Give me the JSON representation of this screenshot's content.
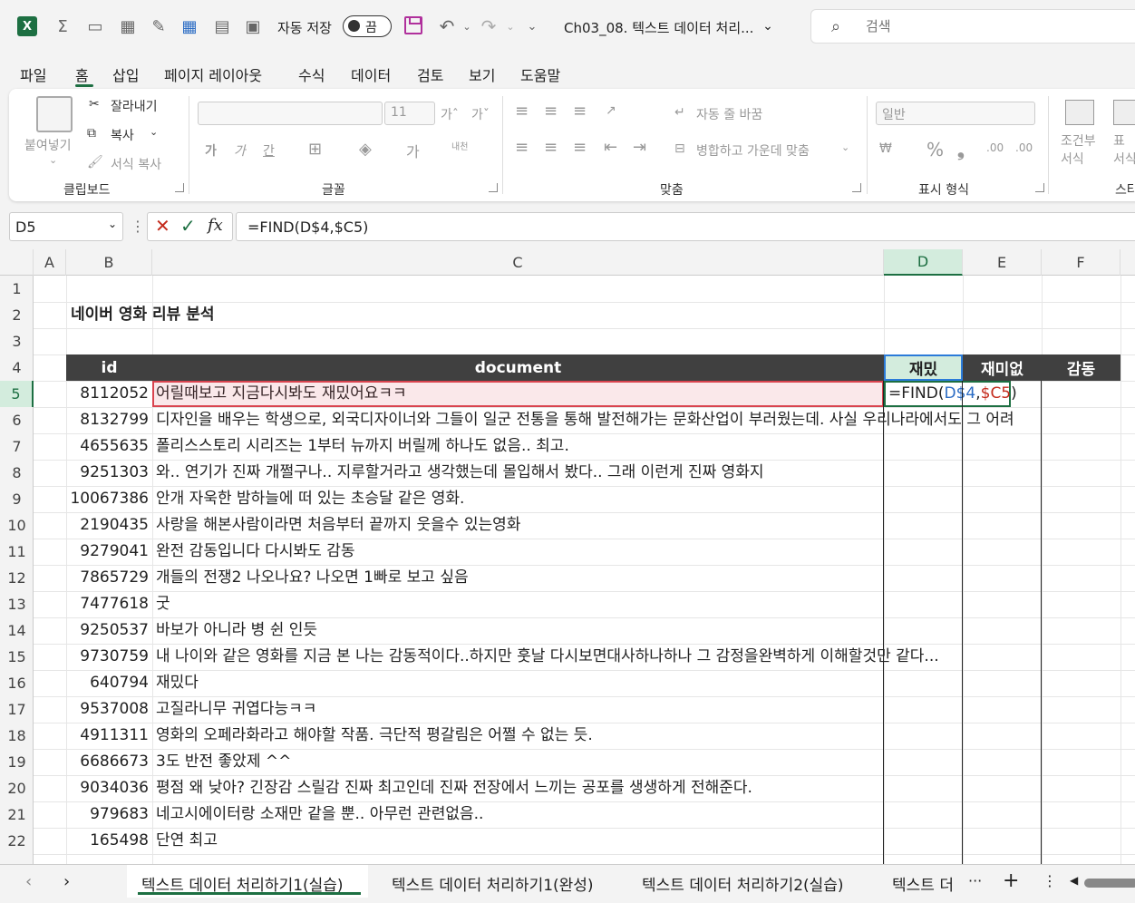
{
  "titlebar": {
    "autosave_label": "자동 저장",
    "autosave_state": "끔",
    "doc_title": "Ch03_08. 텍스트 데이터 처리...",
    "search_placeholder": "검색"
  },
  "menu": [
    "파일",
    "홈",
    "삽입",
    "페이지 레이아웃",
    "수식",
    "데이터",
    "검토",
    "보기",
    "도움말"
  ],
  "ribbon": {
    "clipboard": {
      "paste": "붙여넣기",
      "cut": "잘라내기",
      "copy": "복사",
      "format_painter": "서식 복사",
      "label": "클립보드"
    },
    "font": {
      "size": "11",
      "label": "글꼴",
      "bold": "가",
      "italic": "가",
      "underline": "간"
    },
    "align": {
      "wrap": "자동 줄 바꿈",
      "merge": "병합하고 가운데 맞춤",
      "label": "맞춤"
    },
    "number": {
      "format": "일반",
      "label": "표시 형식"
    },
    "styles": {
      "conditional": "조건부\n서식",
      "table": "표\n서식",
      "label": "스타"
    }
  },
  "formula_bar": {
    "namebox": "D5",
    "formula": "=FIND(D$4,$C5)"
  },
  "columns": [
    "A",
    "B",
    "C",
    "D",
    "E",
    "F"
  ],
  "rows": [
    "1",
    "2",
    "3",
    "4",
    "5",
    "6",
    "7",
    "8",
    "9",
    "10",
    "11",
    "12",
    "13",
    "14",
    "15",
    "16",
    "17",
    "18",
    "19",
    "20",
    "21",
    "22"
  ],
  "sheet": {
    "title": "네이버 영화 리뷰 분석",
    "headers": {
      "id": "id",
      "document": "document",
      "d": "재밌",
      "e": "재미없",
      "f": "감동"
    },
    "active_cell_text": "=FIND(D$4,$C5)",
    "data": [
      {
        "id": "8112052",
        "doc": "어릴때보고 지금다시봐도 재밌어요ㅋㅋ"
      },
      {
        "id": "8132799",
        "doc": "디자인을 배우는 학생으로, 외국디자이너와 그들이 일군 전통을 통해 발전해가는 문화산업이 부러웠는데. 사실 우리나라에서도 그 어려"
      },
      {
        "id": "4655635",
        "doc": "폴리스스토리 시리즈는 1부터 뉴까지 버릴께 하나도 없음.. 최고."
      },
      {
        "id": "9251303",
        "doc": "와.. 연기가 진짜 개쩔구나.. 지루할거라고 생각했는데 몰입해서 봤다.. 그래 이런게 진짜 영화지"
      },
      {
        "id": "10067386",
        "doc": "안개 자욱한 밤하늘에 떠 있는 초승달 같은 영화."
      },
      {
        "id": "2190435",
        "doc": "사랑을 해본사람이라면 처음부터 끝까지 웃을수 있는영화"
      },
      {
        "id": "9279041",
        "doc": "완전 감동입니다 다시봐도 감동"
      },
      {
        "id": "7865729",
        "doc": "개들의 전쟁2 나오나요? 나오면 1빠로 보고 싶음"
      },
      {
        "id": "7477618",
        "doc": "굿"
      },
      {
        "id": "9250537",
        "doc": "바보가 아니라 병 쉰 인듯"
      },
      {
        "id": "9730759",
        "doc": "내 나이와 같은 영화를 지금 본 나는 감동적이다..하지만 훗날 다시보면대사하나하나 그 감정을완벽하게 이해할것만 같다..."
      },
      {
        "id": "640794",
        "doc": "재밌다"
      },
      {
        "id": "9537008",
        "doc": "고질라니무 귀엽다능ㅋㅋ"
      },
      {
        "id": "4911311",
        "doc": "영화의 오페라화라고 해야할 작품. 극단적 평갈림은 어쩔 수 없는 듯."
      },
      {
        "id": "6686673",
        "doc": "3도 반전 좋았제 ^^"
      },
      {
        "id": "9034036",
        "doc": "평점 왜 낮아? 긴장감 스릴감 진짜 최고인데 진짜 전장에서 느끼는 공포를 생생하게 전해준다."
      },
      {
        "id": "979683",
        "doc": "네고시에이터랑 소재만 같을 뿐.. 아무런 관련없음.."
      },
      {
        "id": "165498",
        "doc": "단연 최고"
      }
    ]
  },
  "sheet_tabs": [
    "텍스트 데이터 처리하기1(실습)",
    "텍스트 데이터 처리하기1(완성)",
    "텍스트 데이터 처리하기2(실습)",
    "텍스트 더"
  ],
  "colors": {
    "accent": "#1d6f42",
    "header_fill": "#404040",
    "selection_fill": "#fbe9ea",
    "selection_border": "#d9444f"
  }
}
